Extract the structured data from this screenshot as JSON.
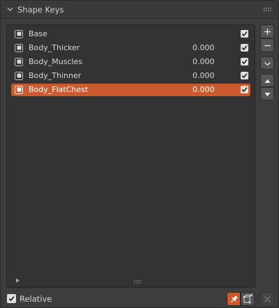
{
  "panel": {
    "title": "Shape Keys",
    "collapse_icon": "chevron-down-icon",
    "grip_icon": "drag-grip-icon"
  },
  "shape_keys": {
    "rows": [
      {
        "name": "Base",
        "value": "",
        "checked": true,
        "active": false
      },
      {
        "name": "Body_Thicker",
        "value": "0.000",
        "checked": true,
        "active": false
      },
      {
        "name": "Body_Muscles",
        "value": "0.000",
        "checked": true,
        "active": false
      },
      {
        "name": "Body_Thinner",
        "value": "0.000",
        "checked": true,
        "active": false
      },
      {
        "name": "Body_FlatChest",
        "value": "0.000",
        "checked": true,
        "active": true
      }
    ]
  },
  "side_buttons": {
    "add": "+",
    "remove": "−"
  },
  "footer": {
    "relative_label": "Relative",
    "relative_checked": true
  },
  "colors": {
    "accent": "#cc5a2f",
    "panel_bg": "#3d3d3d",
    "list_bg": "#333333"
  }
}
